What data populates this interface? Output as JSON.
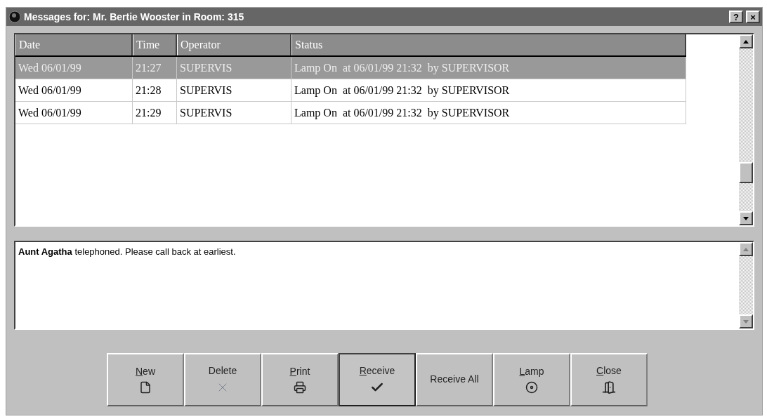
{
  "window": {
    "title": "Messages for: Mr. Bertie Wooster in Room: 315",
    "controls": [
      "?",
      "×"
    ]
  },
  "table": {
    "columns": [
      "Date",
      "Time",
      "Operator",
      "Status"
    ],
    "rows": [
      {
        "cells": [
          "Wed 06/01/99",
          "21:27",
          "SUPERVIS",
          "Lamp On  at 06/01/99 21:32  by SUPERVISOR"
        ],
        "selected": true
      },
      {
        "cells": [
          "Wed 06/01/99",
          "21:28",
          "SUPERVIS",
          "Lamp On  at 06/01/99 21:32  by SUPERVISOR"
        ],
        "selected": false
      },
      {
        "cells": [
          "Wed 06/01/99",
          "21:29",
          "SUPERVIS",
          "Lamp On  at 06/01/99 21:32  by SUPERVISOR"
        ],
        "selected": false
      }
    ]
  },
  "message": {
    "text": "**Aunt Agatha** telephoned. Please call back at earliest."
  },
  "buttons": [
    {
      "label": "New",
      "kind": "new",
      "mnemonic": true,
      "pressed": false
    },
    {
      "label": "Delete",
      "kind": "delete",
      "mnemonic": false,
      "pressed": false
    },
    {
      "label": "Print",
      "kind": "print",
      "mnemonic": true,
      "pressed": false
    },
    {
      "label": "Receive",
      "kind": "receive",
      "mnemonic": true,
      "pressed": true
    },
    {
      "label": "Receive All",
      "kind": "receive_all",
      "mnemonic": false,
      "pressed": false
    },
    {
      "label": "Lamp",
      "kind": "lamp",
      "mnemonic": true,
      "pressed": false
    },
    {
      "label": "Close",
      "kind": "close",
      "mnemonic": true,
      "pressed": false
    }
  ]
}
